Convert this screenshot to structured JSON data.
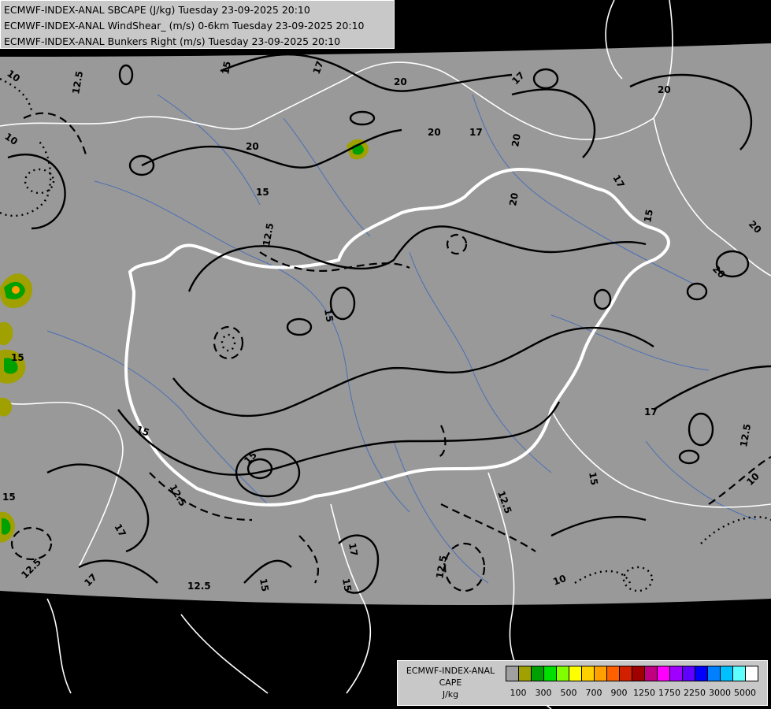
{
  "header": {
    "line1": "ECMWF-INDEX-ANAL SBCAPE (J/kg) Tuesday 23-09-2025 20:10",
    "line2": "ECMWF-INDEX-ANAL WindShear_ (m/s) 0-6km Tuesday 23-09-2025 20:10",
    "line3": "ECMWF-INDEX-ANAL Bunkers Right (m/s) Tuesday 23-09-2025 20:10"
  },
  "legend": {
    "title_line1": "ECMWF-INDEX-ANAL",
    "title_line2": "CAPE",
    "title_line3": "J/kg",
    "colors": [
      "#a0a0a0",
      "#a0a000",
      "#00a000",
      "#00e000",
      "#80ff00",
      "#ffff00",
      "#ffd000",
      "#ffa000",
      "#ff6000",
      "#d02000",
      "#a00000",
      "#c00080",
      "#ff00ff",
      "#a000ff",
      "#6000ff",
      "#0000ff",
      "#0080ff",
      "#00c0ff",
      "#60ffff",
      "#ffffff"
    ],
    "tick_labels": [
      "100",
      "300",
      "500",
      "700",
      "900",
      "1250",
      "1750",
      "2250",
      "3000",
      "5000"
    ]
  },
  "contour_labels": [
    "10",
    "12.5",
    "15",
    "17",
    "20"
  ],
  "colors": {
    "background": "#000000",
    "domain": "#999999",
    "borders": "#ffffff",
    "rivers": "#4a6fb5",
    "contours": "#000000"
  }
}
